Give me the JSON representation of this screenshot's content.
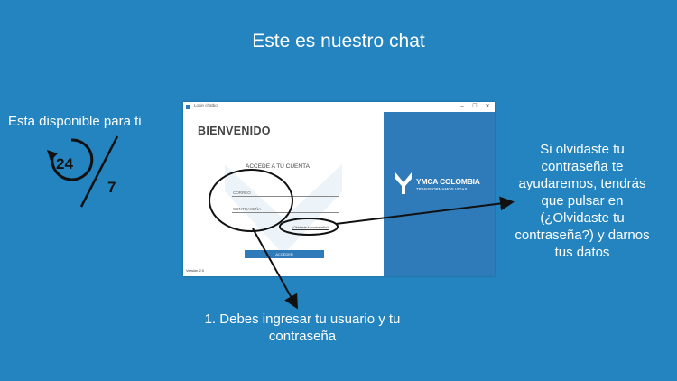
{
  "slide": {
    "title": "Este es nuestro chat",
    "availability_text": "Esta disponible para ti",
    "icon_247": {
      "hours": "24",
      "days": "7"
    },
    "right_note": "Si olvidaste tu contraseña te ayudaremos, tendrás que pulsar en (¿Olvidaste tu contraseña?) y darnos tus datos",
    "bottom_note": "1. Debes ingresar tu usuario y tu contraseña"
  },
  "app": {
    "window_title": "Login chatbot",
    "controls": [
      "–",
      "☐",
      "✕"
    ],
    "welcome": "BIENVENIDO",
    "access_title": "ACCEDE A TU CUENTA",
    "email_label": "CORREO",
    "password_label": "CONTRASEÑA",
    "forgot_link": "¿Olvidaste tu contraseña?",
    "access_button": "ACCEDER",
    "version": "Version 2.0",
    "logo": {
      "name": "YMCA COLOMBIA",
      "tagline": "TRANSFORMAMOS VIDAS"
    }
  },
  "colors": {
    "background": "#2384c0",
    "brand_blue": "#2f7ab8"
  }
}
